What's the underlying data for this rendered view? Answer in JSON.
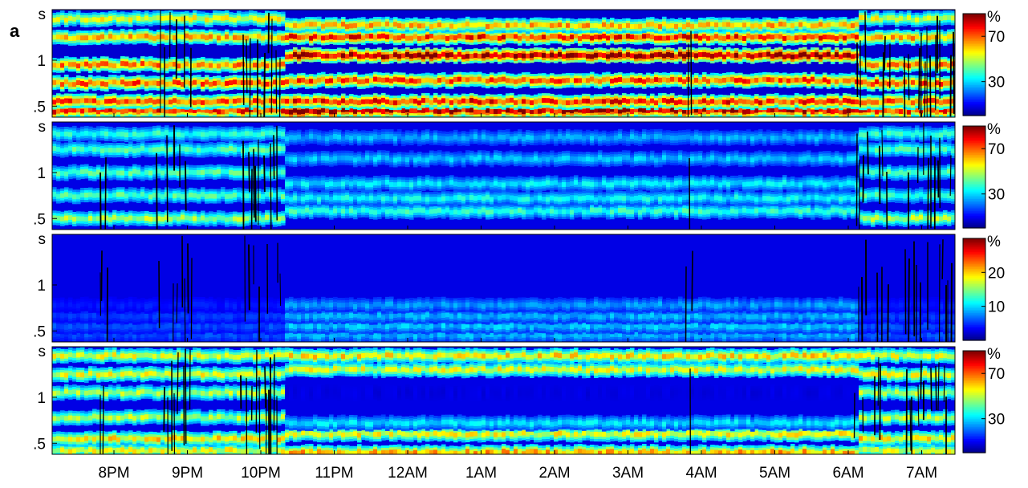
{
  "figure": {
    "panel_label": "a"
  },
  "colors": {
    "colormap": [
      "#00007f",
      "#0000ff",
      "#007fff",
      "#00ffff",
      "#7fff7f",
      "#ffff00",
      "#ff7f00",
      "#ff0000",
      "#7f0000"
    ],
    "artifact": "#000000",
    "frame": "#000000"
  },
  "chart_data": [
    {
      "type": "heatmap",
      "panel": 1,
      "y_ticks": [
        {
          "value": 0.5,
          "label": ".5"
        },
        {
          "value": 1,
          "label": "1"
        }
      ],
      "y_unit_label": "s",
      "x_ticks": [
        "8PM",
        "9PM",
        "10PM",
        "11PM",
        "12AM",
        "1AM",
        "2AM",
        "3AM",
        "4AM",
        "5AM",
        "6AM",
        "7AM"
      ],
      "colorbar": {
        "unit": "%",
        "ticks": [
          {
            "value": 30,
            "label": "30"
          },
          {
            "value": 70,
            "label": "70"
          }
        ],
        "range": [
          0,
          90
        ]
      },
      "bands": [
        {
          "y_wake": 0.45,
          "y_sleep": 0.45,
          "intensity_wake": 0.85,
          "intensity_sleep": 0.95
        },
        {
          "y_wake": 0.55,
          "y_sleep": 0.55,
          "intensity_wake": 0.8,
          "intensity_sleep": 0.85
        },
        {
          "y_wake": 0.75,
          "y_sleep": 0.78,
          "intensity_wake": 0.8,
          "intensity_sleep": 0.8
        },
        {
          "y_wake": 0.95,
          "y_sleep": 1.05,
          "intensity_wake": 0.75,
          "intensity_sleep": 0.95
        },
        {
          "y_wake": 1.25,
          "y_sleep": 1.25,
          "intensity_wake": 0.7,
          "intensity_sleep": 0.85
        },
        {
          "y_wake": 1.45,
          "y_sleep": 1.38,
          "intensity_wake": 0.6,
          "intensity_sleep": 0.7
        }
      ],
      "background": 0.08
    },
    {
      "type": "heatmap",
      "panel": 2,
      "y_ticks": [
        {
          "value": 0.5,
          "label": ".5"
        },
        {
          "value": 1,
          "label": "1"
        }
      ],
      "y_unit_label": "s",
      "x_ticks": [
        "8PM",
        "9PM",
        "10PM",
        "11PM",
        "12AM",
        "1AM",
        "2AM",
        "3AM",
        "4AM",
        "5AM",
        "6AM",
        "7AM"
      ],
      "colorbar": {
        "unit": "%",
        "ticks": [
          {
            "value": 30,
            "label": "30"
          },
          {
            "value": 70,
            "label": "70"
          }
        ],
        "range": [
          0,
          90
        ]
      },
      "bands": [
        {
          "y_wake": 0.5,
          "y_sleep": 0.58,
          "intensity_wake": 0.55,
          "intensity_sleep": 0.42
        },
        {
          "y_wake": 0.75,
          "y_sleep": 0.72,
          "intensity_wake": 0.45,
          "intensity_sleep": 0.38
        },
        {
          "y_wake": 1.0,
          "y_sleep": 0.88,
          "intensity_wake": 0.45,
          "intensity_sleep": 0.36
        },
        {
          "y_wake": 1.25,
          "y_sleep": 1.15,
          "intensity_wake": 0.45,
          "intensity_sleep": 0.32
        },
        {
          "y_wake": 1.42,
          "y_sleep": 1.38,
          "intensity_wake": 0.42,
          "intensity_sleep": 0.3
        }
      ],
      "background": 0.1
    },
    {
      "type": "heatmap",
      "panel": 3,
      "y_ticks": [
        {
          "value": 0.5,
          "label": ".5"
        },
        {
          "value": 1,
          "label": "1"
        }
      ],
      "y_unit_label": "s",
      "x_ticks": [
        "8PM",
        "9PM",
        "10PM",
        "11PM",
        "12AM",
        "1AM",
        "2AM",
        "3AM",
        "4AM",
        "5AM",
        "6AM",
        "7AM"
      ],
      "colorbar": {
        "unit": "%",
        "ticks": [
          {
            "value": 10,
            "label": "10"
          },
          {
            "value": 20,
            "label": "20"
          }
        ],
        "range": [
          0,
          30
        ]
      },
      "bands": [
        {
          "y_wake": 0.45,
          "y_sleep": 0.45,
          "intensity_wake": 0.2,
          "intensity_sleep": 0.3
        },
        {
          "y_wake": 0.55,
          "y_sleep": 0.55,
          "intensity_wake": 0.2,
          "intensity_sleep": 0.32
        },
        {
          "y_wake": 0.66,
          "y_sleep": 0.66,
          "intensity_wake": 0.18,
          "intensity_sleep": 0.3
        },
        {
          "y_wake": 0.78,
          "y_sleep": 0.78,
          "intensity_wake": 0.15,
          "intensity_sleep": 0.28
        }
      ],
      "background": 0.1
    },
    {
      "type": "heatmap",
      "panel": 4,
      "y_ticks": [
        {
          "value": 0.5,
          "label": ".5"
        },
        {
          "value": 1,
          "label": "1"
        }
      ],
      "y_unit_label": "s",
      "x_ticks": [
        "8PM",
        "9PM",
        "10PM",
        "11PM",
        "12AM",
        "1AM",
        "2AM",
        "3AM",
        "4AM",
        "5AM",
        "6AM",
        "7AM"
      ],
      "colorbar": {
        "unit": "%",
        "ticks": [
          {
            "value": 30,
            "label": "30"
          },
          {
            "value": 70,
            "label": "70"
          }
        ],
        "range": [
          0,
          90
        ]
      },
      "bands": [
        {
          "y_wake": 0.42,
          "y_sleep": 0.4,
          "intensity_wake": 0.6,
          "intensity_sleep": 0.7
        },
        {
          "y_wake": 0.55,
          "y_sleep": 0.6,
          "intensity_wake": 0.65,
          "intensity_sleep": 0.62
        },
        {
          "y_wake": 0.78,
          "y_sleep": 0.72,
          "intensity_wake": 0.55,
          "intensity_sleep": 0.35
        },
        {
          "y_wake": 1.05,
          "y_sleep": 1.05,
          "intensity_wake": 0.55,
          "intensity_sleep": 0.1
        },
        {
          "y_wake": 1.25,
          "y_sleep": 1.3,
          "intensity_wake": 0.6,
          "intensity_sleep": 0.6
        },
        {
          "y_wake": 1.45,
          "y_sleep": 1.45,
          "intensity_wake": 0.6,
          "intensity_sleep": 0.65
        }
      ],
      "background": 0.1
    }
  ]
}
